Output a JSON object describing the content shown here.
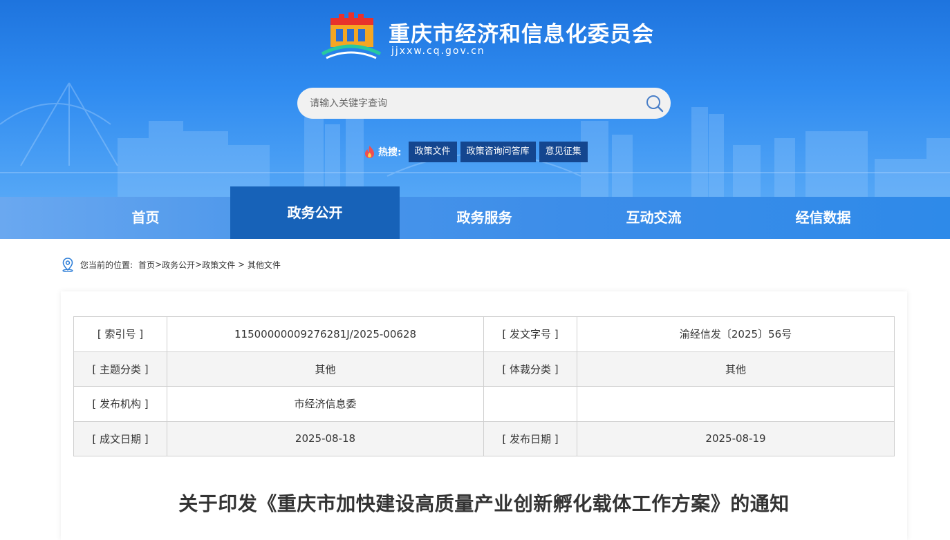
{
  "site": {
    "title": "重庆市经济和信息化委员会",
    "domain": "jjxxw.cq.gov.cn"
  },
  "search": {
    "placeholder": "请输入关键字查询",
    "icon": "search-icon"
  },
  "hot": {
    "label": "热搜:",
    "icon": "flame-icon",
    "tags": [
      "政策文件",
      "政策咨询问答库",
      "意见征集"
    ]
  },
  "nav": {
    "items": [
      {
        "label": "首页",
        "active": false
      },
      {
        "label": "政务公开",
        "active": true
      },
      {
        "label": "政务服务",
        "active": false
      },
      {
        "label": "互动交流",
        "active": false
      },
      {
        "label": "经信数据",
        "active": false
      }
    ]
  },
  "breadcrumb": {
    "prefix": "您当前的位置:",
    "items": [
      "首页",
      ">",
      "政务公开",
      ">",
      "政策文件",
      " > ",
      "其他文件"
    ]
  },
  "meta": {
    "rows": [
      [
        "[ 索引号 ]",
        "11500000009276281J/2025-00628",
        "[ 发文字号 ]",
        "渝经信发〔2025〕56号"
      ],
      [
        "[ 主题分类 ]",
        "其他",
        "[ 体裁分类 ]",
        "其他"
      ],
      [
        "[ 发布机构 ]",
        "市经济信息委",
        "",
        ""
      ],
      [
        "[ 成文日期 ]",
        "2025-08-18",
        "[ 发布日期 ]",
        "2025-08-19"
      ]
    ]
  },
  "document": {
    "title": "关于印发《重庆市加快建设高质量产业创新孵化载体工作方案》的通知"
  },
  "colors": {
    "header_top": "#1e74de",
    "nav_active": "#1762b8",
    "hot_tag": "#14468f"
  }
}
